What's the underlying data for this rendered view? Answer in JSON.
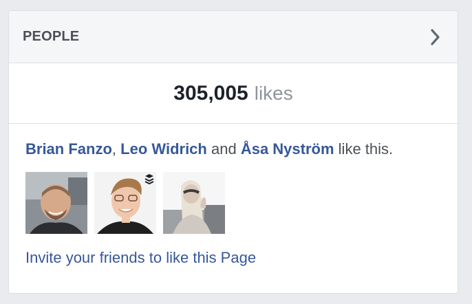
{
  "header": {
    "title": "PEOPLE",
    "chevron_icon": "chevron-right-icon"
  },
  "likes": {
    "count": "305,005",
    "word": "likes"
  },
  "friends": {
    "names": [
      "Brian Fanzo",
      "Leo Widrich",
      "Åsa Nyström"
    ],
    "separator": ",",
    "conjunction": "and",
    "suffix": "like this."
  },
  "avatars": [
    {
      "icon": "person-avatar-icon"
    },
    {
      "icon": "person-avatar-icon",
      "badge_icon": "layers-icon"
    },
    {
      "icon": "person-avatar-icon"
    }
  ],
  "invite": {
    "label": "Invite your friends to like this Page"
  },
  "colors": {
    "link": "#365899",
    "header_bg": "#f5f6f7",
    "page_bg": "#e9ebee",
    "muted": "#90949c"
  }
}
